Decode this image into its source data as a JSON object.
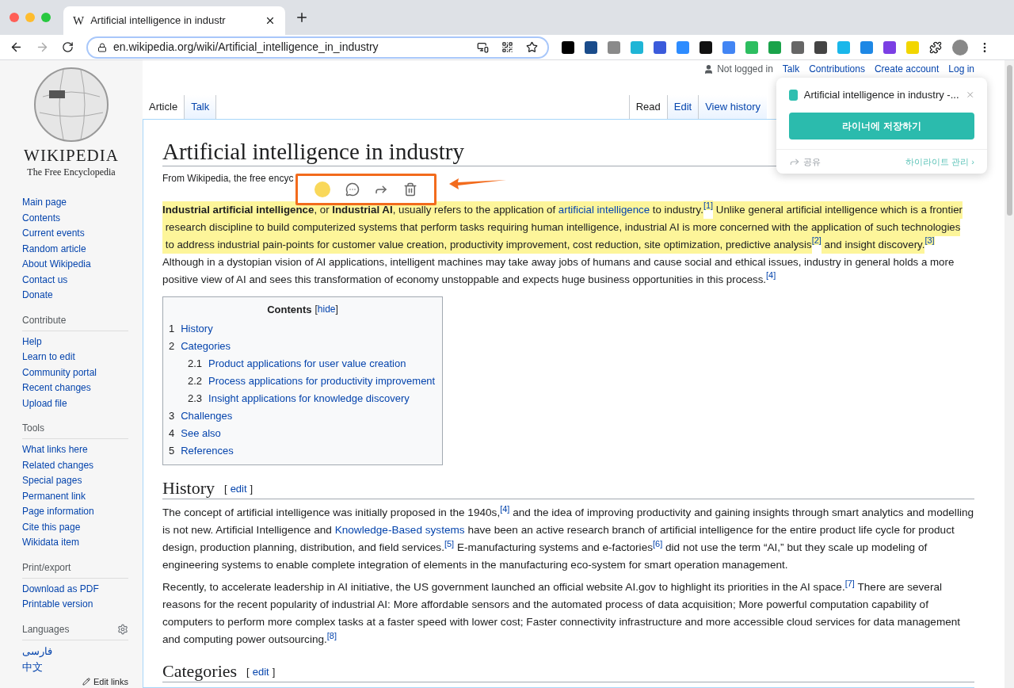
{
  "browser": {
    "favicon": "W",
    "tab_title": "Artificial intelligence in industr",
    "url": "en.wikipedia.org/wiki/Artificial_intelligence_in_industry",
    "extensions": [
      {
        "color": "#000000"
      },
      {
        "color": "#1a4c8b"
      },
      {
        "color": "#8a8a8a"
      },
      {
        "color": "#1fb5d6"
      },
      {
        "color": "#3b5bdb"
      },
      {
        "color": "#2d8cff"
      },
      {
        "color": "#111111"
      },
      {
        "color": "#4285f4"
      },
      {
        "color": "#2dbe60"
      },
      {
        "color": "#1aa34a"
      },
      {
        "color": "#666666"
      },
      {
        "color": "#444444"
      },
      {
        "color": "#1ab7ea"
      },
      {
        "color": "#1e88e5"
      },
      {
        "color": "#7b3fe4"
      },
      {
        "color": "#f2d600"
      }
    ]
  },
  "logo": {
    "wordmark": "WIKIPEDIA",
    "tagline": "The Free Encyclopedia"
  },
  "sidebar": [
    {
      "items": [
        "Main page",
        "Contents",
        "Current events",
        "Random article",
        "About Wikipedia",
        "Contact us",
        "Donate"
      ]
    },
    {
      "heading": "Contribute",
      "items": [
        "Help",
        "Learn to edit",
        "Community portal",
        "Recent changes",
        "Upload file"
      ]
    },
    {
      "heading": "Tools",
      "items": [
        "What links here",
        "Related changes",
        "Special pages",
        "Permanent link",
        "Page information",
        "Cite this page",
        "Wikidata item"
      ]
    },
    {
      "heading": "Print/export",
      "items": [
        "Download as PDF",
        "Printable version"
      ]
    }
  ],
  "languages": {
    "heading": "Languages",
    "items": [
      "فارسی",
      "中文"
    ],
    "edit_links": "Edit links"
  },
  "personal": {
    "status": "Not logged in",
    "links": [
      "Talk",
      "Contributions",
      "Create account",
      "Log in"
    ]
  },
  "namespace_tabs": [
    {
      "label": "Article",
      "selected": true
    },
    {
      "label": "Talk",
      "selected": false
    }
  ],
  "view_tabs": [
    {
      "label": "Read",
      "selected": true
    },
    {
      "label": "Edit",
      "selected": false
    },
    {
      "label": "View history",
      "selected": false
    }
  ],
  "title": "Artificial intelligence in industry",
  "subtitle": "From Wikipedia, the free encyc",
  "highlight_toolbar": {
    "color": "#f9d85a"
  },
  "intro": [
    {
      "kind": "bold",
      "text": "Industrial artificial intelligence",
      "highlighted": true
    },
    {
      "kind": "text",
      "text": ", or ",
      "highlighted": true
    },
    {
      "kind": "bold",
      "text": "Industrial AI",
      "highlighted": true
    },
    {
      "kind": "text",
      "text": ", usually refers to the application of ",
      "highlighted": true
    },
    {
      "kind": "link",
      "text": "artificial intelligence",
      "highlighted": true
    },
    {
      "kind": "text",
      "text": " to industry.",
      "highlighted": true
    },
    {
      "kind": "ref",
      "text": "[1]",
      "highlighted": true
    },
    {
      "kind": "text",
      "text": " Unlike general artificial intelligence which is a frontier",
      "highlighted": true
    },
    {
      "kind": "text",
      "text": " research discipline to build computerized systems that perform tasks requiring human intelligence, industrial AI is more concerned with the application of such technologies",
      "highlighted": true
    },
    {
      "kind": "text",
      "text": " to address industrial pain-points for customer value creation, productivity improvement, cost reduction, site optimization, predictive analysis",
      "highlighted": true
    },
    {
      "kind": "ref",
      "text": "[2]",
      "highlighted": true
    },
    {
      "kind": "text",
      "text": " and insight discovery.",
      "highlighted": true
    },
    {
      "kind": "ref",
      "text": "[3]",
      "highlighted": true
    },
    {
      "kind": "text",
      "text": " Although in a dystopian vision of AI applications, intelligent machines may take away jobs of humans and cause social and ethical issues, industry in general holds a more positive view of AI and sees this transformation of economy unstoppable and expects huge business opportunities in this process.",
      "highlighted": false
    },
    {
      "kind": "ref",
      "text": "[4]",
      "highlighted": false
    }
  ],
  "toc": {
    "title": "Contents",
    "bracket_open": "[",
    "toggle": "hide",
    "bracket_close": "]",
    "items": [
      {
        "number": "1",
        "label": "History"
      },
      {
        "number": "2",
        "label": "Categories",
        "children": [
          {
            "number": "2.1",
            "label": "Product applications for user value creation"
          },
          {
            "number": "2.2",
            "label": "Process applications for productivity improvement"
          },
          {
            "number": "2.3",
            "label": "Insight applications for knowledge discovery"
          }
        ]
      },
      {
        "number": "3",
        "label": "Challenges"
      },
      {
        "number": "4",
        "label": "See also"
      },
      {
        "number": "5",
        "label": "References"
      }
    ]
  },
  "sections": [
    {
      "heading": "History",
      "bracket_open": "[",
      "edit": "edit",
      "bracket_close": "]",
      "paragraphs": [
        [
          {
            "kind": "text",
            "text": "The concept of artificial intelligence was initially proposed in the 1940s,",
            "highlighted": false
          },
          {
            "kind": "ref",
            "text": "[4]",
            "highlighted": false
          },
          {
            "kind": "text",
            "text": " and the idea of improving productivity and gaining insights through smart analytics and modelling is not new. Artificial Intelligence and ",
            "highlighted": false
          },
          {
            "kind": "link",
            "text": "Knowledge-Based systems",
            "highlighted": false
          },
          {
            "kind": "text",
            "text": " have been an active research branch of artificial intelligence for the entire product life cycle for product design, production planning, distribution, and field services.",
            "highlighted": false
          },
          {
            "kind": "ref",
            "text": "[5]",
            "highlighted": false
          },
          {
            "kind": "text",
            "text": " E-manufacturing systems and e-factories",
            "highlighted": false
          },
          {
            "kind": "ref",
            "text": "[6]",
            "highlighted": false
          },
          {
            "kind": "text",
            "text": " did not use the term “AI,” but they scale up modeling of engineering systems to enable complete integration of elements in the manufacturing eco-system for smart operation management.",
            "highlighted": false
          }
        ],
        [
          {
            "kind": "text",
            "text": "Recently, to accelerate leadership in AI initiative, the US government launched an official website AI.gov to highlight its priorities in the AI space.",
            "highlighted": false
          },
          {
            "kind": "ref",
            "text": "[7]",
            "highlighted": false
          },
          {
            "kind": "text",
            "text": " There are several reasons for the recent popularity of industrial AI: More affordable sensors and the automated process of data acquisition; More powerful computation capability of computers to perform more complex tasks at a faster speed with lower cost; Faster connectivity infrastructure and more accessible cloud services for data management and computing power outsourcing.",
            "highlighted": false
          },
          {
            "kind": "ref",
            "text": "[8]",
            "highlighted": false
          }
        ]
      ]
    },
    {
      "heading": "Categories",
      "bracket_open": "[",
      "edit": "edit",
      "bracket_close": "]"
    }
  ],
  "liner_popup": {
    "title": "Artificial intelligence in industry -...",
    "save": "라이너에 저장하기",
    "share": "공유",
    "manage": "하이라이트 관리 ›"
  }
}
